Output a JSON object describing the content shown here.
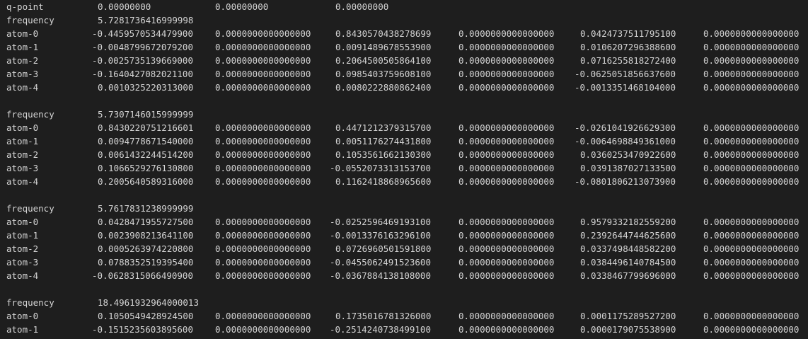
{
  "qpoint": {
    "label": "q-point",
    "values": [
      "0.00000000",
      "0.00000000",
      "0.00000000"
    ]
  },
  "modes": [
    {
      "label": "frequency",
      "value": "5.7281736416999998",
      "atoms": [
        {
          "label": "atom-0",
          "values": [
            "-0.4459570534479900",
            "0.0000000000000000",
            "0.8430570438278699",
            "0.0000000000000000",
            "0.0424737511795100",
            "0.0000000000000000"
          ]
        },
        {
          "label": "atom-1",
          "values": [
            "-0.0048799672079200",
            "0.0000000000000000",
            "0.0091489678553900",
            "0.0000000000000000",
            "0.0106207296388600",
            "0.0000000000000000"
          ]
        },
        {
          "label": "atom-2",
          "values": [
            "-0.0025735139669000",
            "0.0000000000000000",
            "0.2064500505864100",
            "0.0000000000000000",
            "0.0716255818272400",
            "0.0000000000000000"
          ]
        },
        {
          "label": "atom-3",
          "values": [
            "-0.1640427082021100",
            "0.0000000000000000",
            "0.0985403759608100",
            "0.0000000000000000",
            "-0.0625051856637600",
            "0.0000000000000000"
          ]
        },
        {
          "label": "atom-4",
          "values": [
            "0.0010325220313000",
            "0.0000000000000000",
            "0.0080222880862400",
            "0.0000000000000000",
            "-0.0013351468104000",
            "0.0000000000000000"
          ]
        }
      ]
    },
    {
      "label": "frequency",
      "value": "5.7307146015999999",
      "atoms": [
        {
          "label": "atom-0",
          "values": [
            "0.8430220751216601",
            "0.0000000000000000",
            "0.4471212379315700",
            "0.0000000000000000",
            "-0.0261041926629300",
            "0.0000000000000000"
          ]
        },
        {
          "label": "atom-1",
          "values": [
            "0.0094778671540000",
            "0.0000000000000000",
            "0.0051176274431800",
            "0.0000000000000000",
            "-0.0064698849361000",
            "0.0000000000000000"
          ]
        },
        {
          "label": "atom-2",
          "values": [
            "0.0061432244514200",
            "0.0000000000000000",
            "0.1053561662130300",
            "0.0000000000000000",
            "0.0360253470922600",
            "0.0000000000000000"
          ]
        },
        {
          "label": "atom-3",
          "values": [
            "0.1066529276130800",
            "0.0000000000000000",
            "-0.0552073313153700",
            "0.0000000000000000",
            "0.0391387027133500",
            "0.0000000000000000"
          ]
        },
        {
          "label": "atom-4",
          "values": [
            "0.2005640589316000",
            "0.0000000000000000",
            "0.1162418868965600",
            "0.0000000000000000",
            "-0.0801806213073900",
            "0.0000000000000000"
          ]
        }
      ]
    },
    {
      "label": "frequency",
      "value": "5.7617831238999999",
      "atoms": [
        {
          "label": "atom-0",
          "values": [
            "0.0428471955727500",
            "0.0000000000000000",
            "-0.0252596469193100",
            "0.0000000000000000",
            "0.9579332182559200",
            "0.0000000000000000"
          ]
        },
        {
          "label": "atom-1",
          "values": [
            "0.0023908213641100",
            "0.0000000000000000",
            "-0.0013376163296100",
            "0.0000000000000000",
            "0.2392644744625600",
            "0.0000000000000000"
          ]
        },
        {
          "label": "atom-2",
          "values": [
            "0.0005263974220800",
            "0.0000000000000000",
            "0.0726960501591800",
            "0.0000000000000000",
            "0.0337498448582200",
            "0.0000000000000000"
          ]
        },
        {
          "label": "atom-3",
          "values": [
            "0.0788352519395400",
            "0.0000000000000000",
            "-0.0455062491523600",
            "0.0000000000000000",
            "0.0384496140784500",
            "0.0000000000000000"
          ]
        },
        {
          "label": "atom-4",
          "values": [
            "-0.0628315066490900",
            "0.0000000000000000",
            "-0.0367884138108000",
            "0.0000000000000000",
            "0.0338467799696000",
            "0.0000000000000000"
          ]
        }
      ]
    },
    {
      "label": "frequency",
      "value": "18.4961932964000013",
      "atoms": [
        {
          "label": "atom-0",
          "values": [
            "0.1050549428924500",
            "0.0000000000000000",
            "0.1735016781326000",
            "0.0000000000000000",
            "0.0001175289527200",
            "0.0000000000000000"
          ]
        },
        {
          "label": "atom-1",
          "values": [
            "-0.1515235603895600",
            "0.0000000000000000",
            "-0.2514240738499100",
            "0.0000000000000000",
            "0.0000179075538900",
            "0.0000000000000000"
          ]
        }
      ]
    }
  ]
}
